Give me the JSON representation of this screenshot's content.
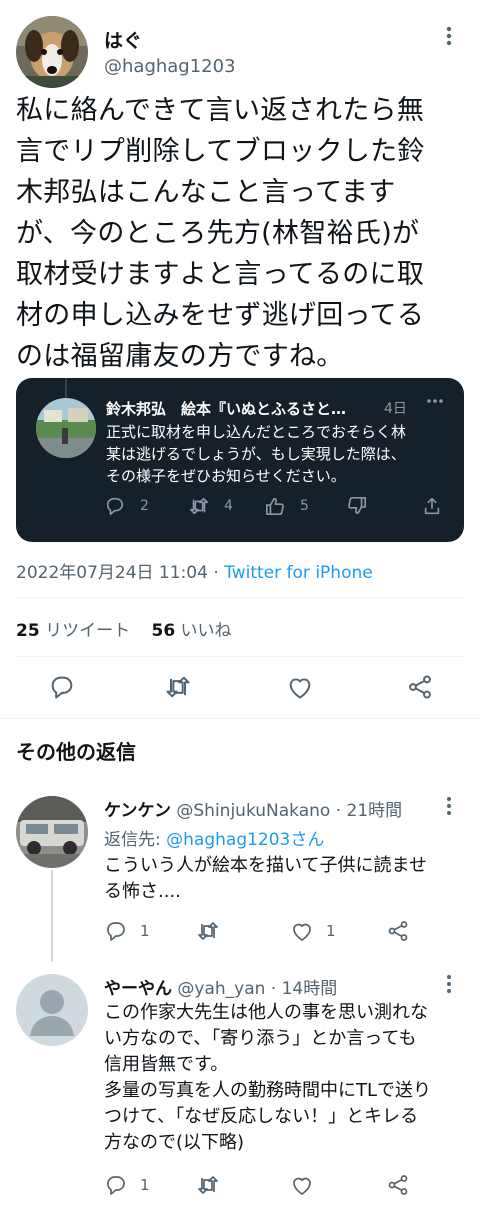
{
  "main_tweet": {
    "display_name": "はぐ",
    "handle": "@haghag1203",
    "text_lines": [
      "私に絡んできて言い返されたら無",
      "言でリプ削除してブロックした鈴",
      "木邦弘はこんなこと言ってます",
      "が、今のところ先方(林智裕氏)が",
      "取材受けますよと言ってるのに取",
      "材の申し込みをせず逃げ回ってる",
      "のは福留庸友の方ですね。"
    ],
    "timestamp": "2022年07月24日 11:04",
    "separator": " · ",
    "source": "Twitter for iPhone",
    "retweet_count": "25",
    "retweet_label": " リツイート",
    "like_count": "56",
    "like_label": " いいね"
  },
  "quoted_tweet": {
    "header": "鈴木邦弘　絵本『いぬとふるさと…",
    "time": "4日",
    "text_lines": [
      "正式に取材を申し込んだところでおそらく林",
      "某は逃げるでしょうが、もし実現した際は、",
      "その様子をぜひお知らせください。"
    ],
    "reply_count": "2",
    "retweet_count": "4",
    "like_count": "5"
  },
  "section_title": "その他の返信",
  "replies": [
    {
      "display_name": "ケンケン",
      "handle_time": " @ShinjukuNakano · 21時間",
      "reply_to_label": "返信先: ",
      "reply_to_handle": "@haghag1203さん",
      "text_lines": [
        "こういう人が絵本を描いて子供に読ませ",
        "る怖さ...."
      ],
      "reply_count": "1",
      "retweet_count": "",
      "like_count": "1"
    },
    {
      "display_name": "やーやん",
      "handle_time": " @yah_yan · 14時間",
      "text_lines": [
        "この作家大先生は他人の事を思い測れな",
        "い方なので、「寄り添う」とか言っても",
        "信用皆無です。",
        "多量の写真を人の勤務時間中にTLで送り",
        "つけて、「なぜ反応しない！」とキレる",
        "方なので(以下略)"
      ],
      "reply_count": "1",
      "retweet_count": "",
      "like_count": ""
    }
  ],
  "icons": [
    "more-icon",
    "reply-icon",
    "retweet-icon",
    "like-icon",
    "share-icon",
    "thumbs-up-icon",
    "thumbs-down-icon"
  ],
  "colors": {
    "link": "#1d9bf0",
    "secondary": "#536471",
    "quote_bg": "#15202b"
  }
}
